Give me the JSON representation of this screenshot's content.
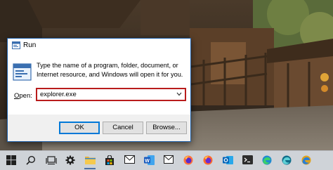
{
  "dialog": {
    "title": "Run",
    "description": "Type the name of a program, folder, document, or Internet resource, and Windows will open it for you.",
    "open_label_accel": "O",
    "open_label_rest": "pen:",
    "input_value": "explorer.exe",
    "buttons": {
      "ok": "OK",
      "cancel": "Cancel",
      "browse": "Browse..."
    }
  },
  "taskbar": {
    "items": [
      {
        "icon": "windows-start-icon"
      },
      {
        "icon": "search-icon"
      },
      {
        "icon": "task-view-icon"
      },
      {
        "icon": "settings-gear-icon"
      },
      {
        "icon": "file-explorer-icon"
      },
      {
        "icon": "microsoft-store-icon"
      },
      {
        "icon": "word-icon"
      },
      {
        "icon": "firefox-icon"
      },
      {
        "icon": "firefox-icon"
      },
      {
        "icon": "outlook-icon"
      },
      {
        "icon": "terminal-icon"
      },
      {
        "icon": "edge-icon"
      },
      {
        "icon": "edge-dev-icon"
      },
      {
        "icon": "edge-canary-icon"
      }
    ]
  },
  "colors": {
    "accent": "#0078d7",
    "highlight_border": "#b91c1c",
    "taskbar": "#cfd3d8"
  }
}
